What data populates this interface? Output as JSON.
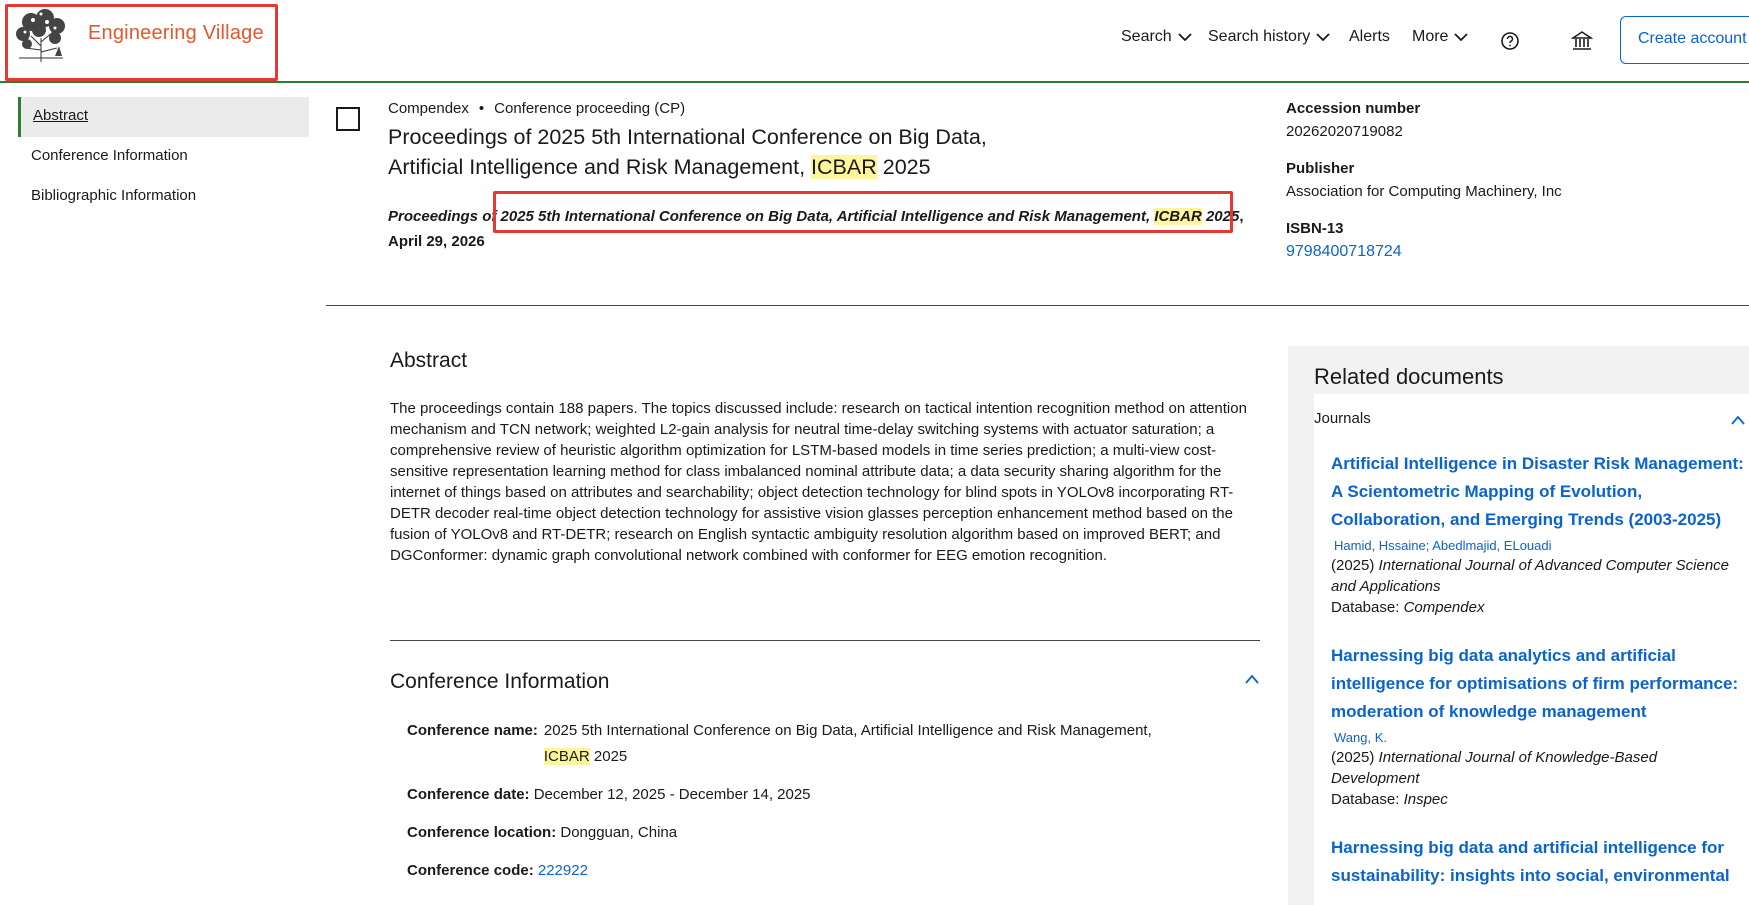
{
  "header": {
    "brand": "Engineering Village",
    "nav": {
      "search": "Search",
      "search_history": "Search history",
      "alerts": "Alerts",
      "more": "More"
    },
    "create_account": "Create account"
  },
  "sidebar": {
    "items": [
      {
        "label": "Abstract"
      },
      {
        "label": "Conference Information"
      },
      {
        "label": "Bibliographic Information"
      }
    ]
  },
  "record": {
    "database": "Compendex",
    "doc_type": "Conference proceeding (CP)",
    "title_part1": "Proceedings of 2025 5th International Conference on Big Data, Artificial Intelligence and Risk Management, ",
    "title_hl": "ICBAR",
    "title_part2": " 2025",
    "source_part1": "Proceedings of 2025 5th International Conference on Big Data, Artificial Intelligence and Risk Management, ",
    "source_hl": "ICBAR",
    "source_part2": " 2025",
    "source_date": ", April 29, 2026"
  },
  "details": {
    "accession_label": "Accession number",
    "accession_value": "20262020719082",
    "publisher_label": "Publisher",
    "publisher_value": "Association for Computing Machinery, Inc",
    "isbn_label": "ISBN-13",
    "isbn_value": "9798400718724"
  },
  "abstract": {
    "heading": "Abstract",
    "text": "The proceedings contain 188 papers. The topics discussed include: research on tactical intention recognition method on attention mechanism and TCN network; weighted L2-gain analysis for neutral time-delay switching systems with actuator saturation; a comprehensive review of heuristic algorithm optimization for LSTM-based models in time series prediction; a multi-view cost-sensitive representation learning method for class imbalanced nominal attribute data; a data security sharing algorithm for the internet of things based on attributes and searchability; object detection technology for blind spots in YOLOv8 incorporating RT-DETR decoder real-time object detection technology for assistive vision glasses perception enhancement method based on the fusion of YOLOv8 and RT-DETR; research on English syntactic ambiguity resolution algorithm based on improved BERT; and DGConformer: dynamic graph convolutional network combined with conformer for EEG emotion recognition."
  },
  "conference": {
    "heading": "Conference Information",
    "name_label": "Conference name:",
    "name_value": "2025 5th International Conference on Big Data, Artificial Intelligence and Risk Management,",
    "name_hl": "ICBAR",
    "name_tail": " 2025",
    "date_label": "Conference date:",
    "date_value": "December 12, 2025 - December 14, 2025",
    "location_label": "Conference location:",
    "location_value": "Dongguan, China",
    "code_label": "Conference code:",
    "code_value": "222922"
  },
  "related": {
    "heading": "Related documents",
    "group": "Journals",
    "items": [
      {
        "title": "Artificial Intelligence in Disaster Risk Management: A Scientometric Mapping of Evolution, Collaboration, and Emerging Trends (2003-2025)",
        "authors": "Hamid, Hssaine; Abedlmajid, ELouadi",
        "year": "(2025)",
        "journal": "International Journal of Advanced Computer Science and Applications",
        "db_label": "Database:",
        "db": "Compendex"
      },
      {
        "title": "Harnessing big data analytics and artificial intelligence for optimisations of firm performance: moderation of knowledge management",
        "authors": "Wang, K.",
        "year": "(2025)",
        "journal": "International Journal of Knowledge-Based Development",
        "db_label": "Database:",
        "db": "Inspec"
      },
      {
        "title": "Harnessing big data and artificial intelligence for sustainability: insights into social, environmental"
      }
    ]
  },
  "colors": {
    "brand": "#e4572e",
    "link": "#0b63ce",
    "highlight": "#fff59d",
    "annotation": "#e53935",
    "accent": "#2e7d32"
  },
  "icons": [
    "library-tree-logo",
    "chevron-down-icon",
    "help-circle-icon",
    "institution-icon",
    "chevron-up-icon"
  ]
}
